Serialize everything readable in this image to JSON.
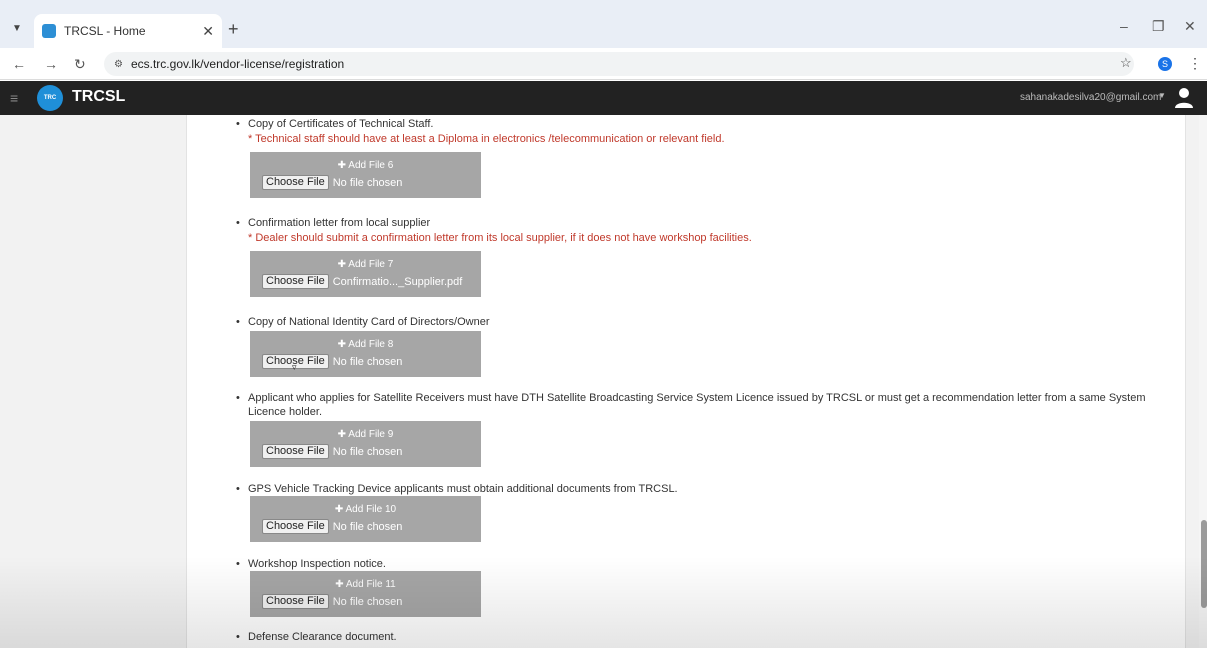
{
  "browser": {
    "tab_title": "TRCSL - Home",
    "url": "ecs.trc.gov.lk/vendor-license/registration",
    "profile_initial": "S"
  },
  "app": {
    "brand": "TRCSL",
    "logo_text": "TRC",
    "user_email": "sahanakadesilva20@gmail.com"
  },
  "items": [
    {
      "label": "Copy of Certificates of Technical Staff.",
      "note": "* Technical staff should have at least a Diploma in electronics /telecommunication or relevant field.",
      "add_label": "Add File 6",
      "button_label": "Choose File",
      "file_name": "No file chosen"
    },
    {
      "label": "Confirmation letter from local supplier",
      "note": "* Dealer should submit a confirmation letter from its local supplier, if it does not have workshop facilities.",
      "add_label": "Add File 7",
      "button_label": "Choose File",
      "file_name": "Confirmatio..._Supplier.pdf"
    },
    {
      "label": "Copy of National Identity Card of Directors/Owner",
      "add_label": "Add File 8",
      "button_label": "Choose File",
      "file_name": "No file chosen"
    },
    {
      "label": "Applicant who applies for Satellite Receivers must have DTH Satellite Broadcasting Service System Licence issued by TRCSL or must get a recommendation letter from a same System Licence holder.",
      "add_label": "Add File 9",
      "button_label": "Choose File",
      "file_name": "No file chosen"
    },
    {
      "label": "GPS Vehicle Tracking Device applicants must obtain additional documents from TRCSL.",
      "add_label": "Add File 10",
      "button_label": "Choose File",
      "file_name": "No file chosen"
    },
    {
      "label": "Workshop Inspection notice.",
      "add_label": "Add File 11",
      "button_label": "Choose File",
      "file_name": "No file chosen"
    },
    {
      "label": "Defense Clearance document."
    }
  ],
  "colors": {
    "note": "#c0392b",
    "dropzone": "#a6a6a6",
    "header": "#222222",
    "accent": "#1f8fd8"
  }
}
